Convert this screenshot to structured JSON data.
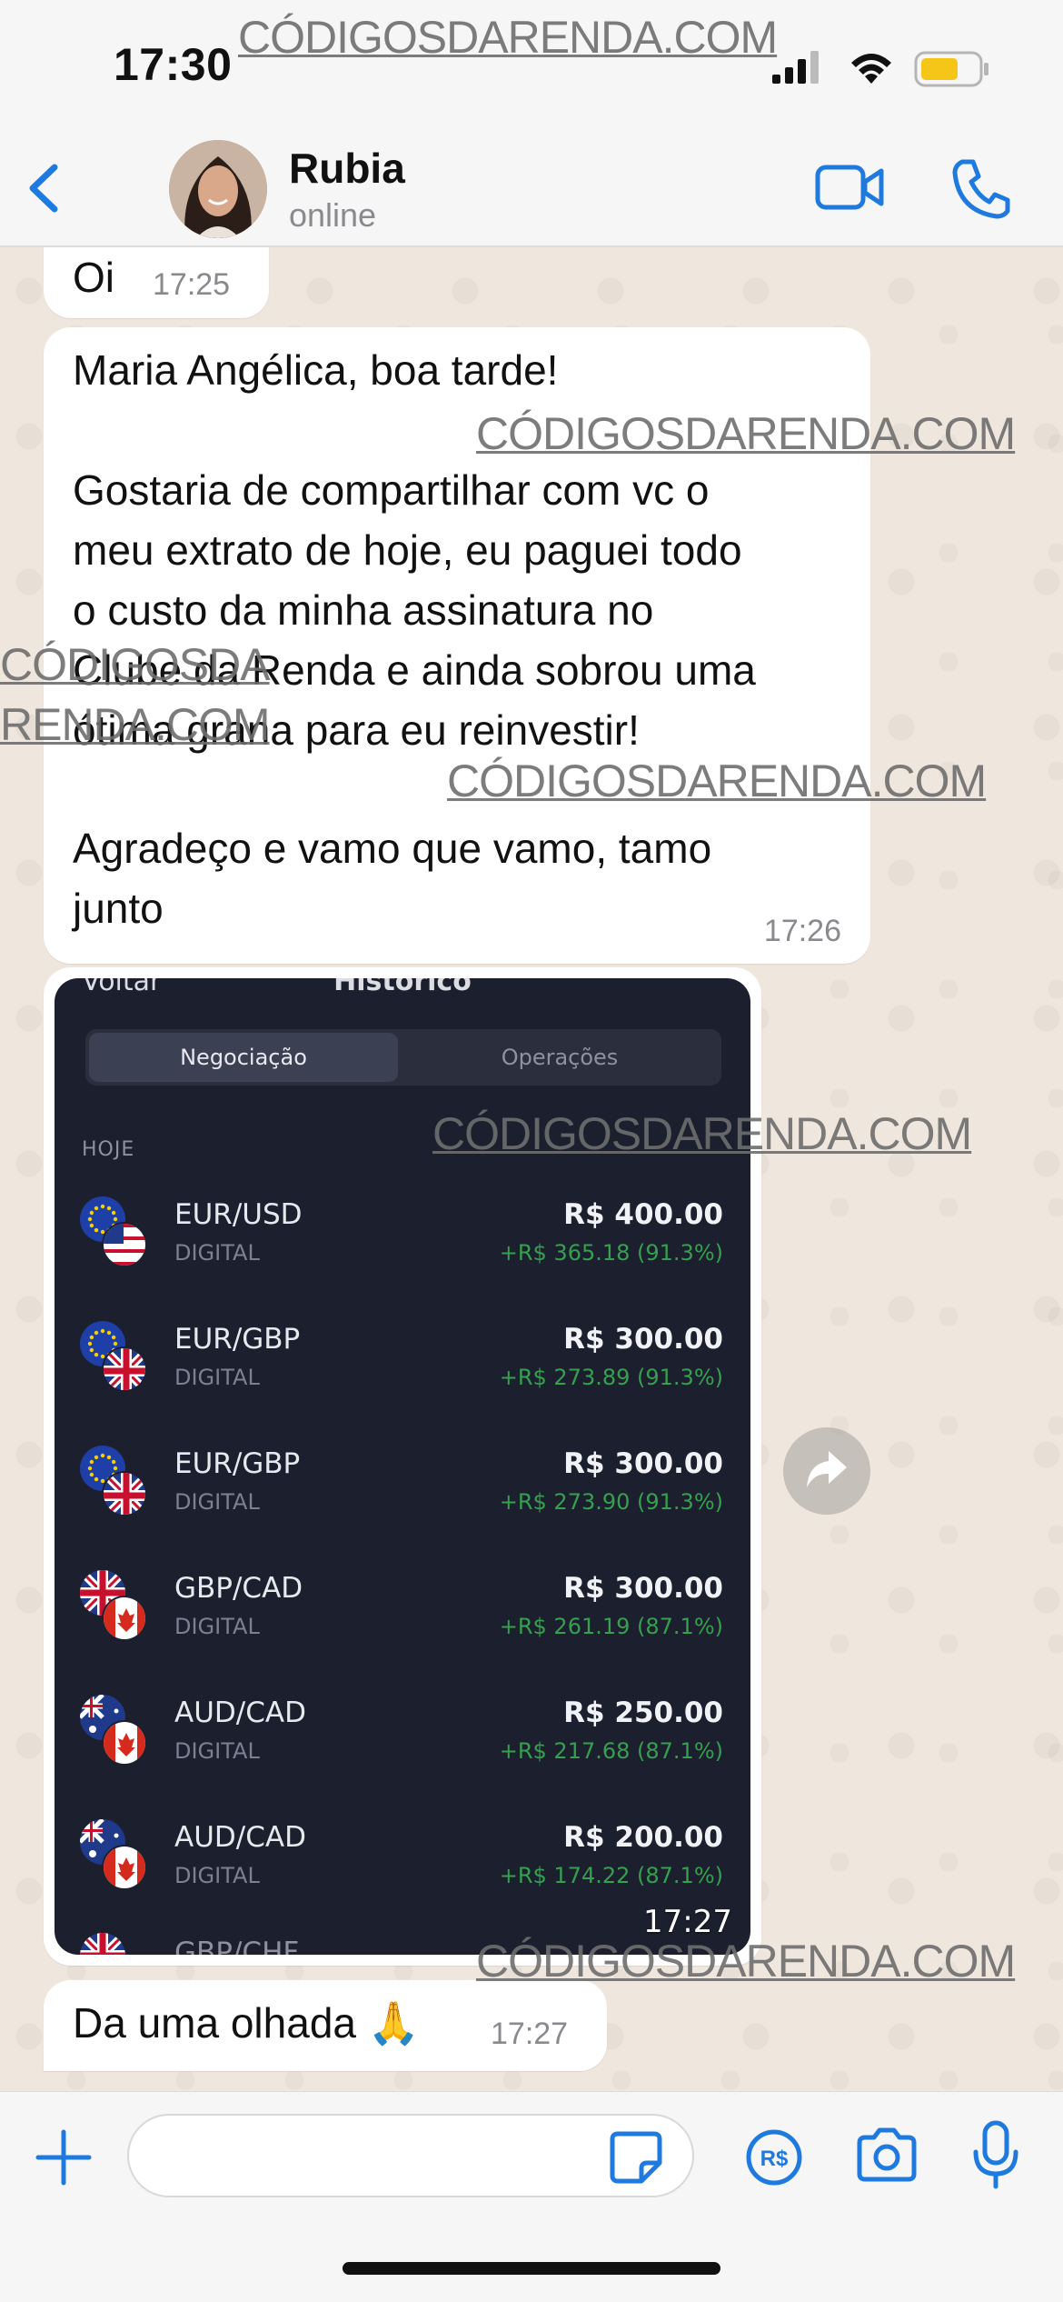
{
  "status_bar": {
    "time": "17:30",
    "icons": [
      "signal-icon",
      "wifi-icon",
      "battery-icon"
    ]
  },
  "header": {
    "contact_name": "Rubia",
    "contact_status": "online",
    "icons": [
      "back-chevron-icon",
      "video-call-icon",
      "phone-icon"
    ]
  },
  "messages": {
    "oi": {
      "text": "Oi",
      "time": "17:25"
    },
    "long": {
      "p1": "Maria Angélica, boa tarde!",
      "p2_lines": [
        "Gostaria de compartilhar com vc o",
        "meu extrato de hoje, eu paguei todo",
        "o custo da minha assinatura no",
        "Clube da Renda e ainda sobrou uma",
        "ótima grana para eu reinvestir!"
      ],
      "p3_lines": [
        "Agradeço e vamo que vamo, tamo",
        "junto"
      ],
      "time": "17:26"
    },
    "image": {
      "time": "17:27",
      "nav_back": "Voltar",
      "nav_title": "Histórico",
      "tab_active": "Negociação",
      "tab_inactive": "Operações",
      "section": "HOJE",
      "trades": [
        {
          "pair": "EUR/USD",
          "kind": "DIGITAL",
          "amount": "R$ 400.00",
          "profit": "+R$ 365.18 (91.3%)",
          "flags": [
            "eu",
            "us"
          ]
        },
        {
          "pair": "EUR/GBP",
          "kind": "DIGITAL",
          "amount": "R$ 300.00",
          "profit": "+R$ 273.89 (91.3%)",
          "flags": [
            "eu",
            "gb"
          ]
        },
        {
          "pair": "EUR/GBP",
          "kind": "DIGITAL",
          "amount": "R$ 300.00",
          "profit": "+R$ 273.90 (91.3%)",
          "flags": [
            "eu",
            "gb"
          ]
        },
        {
          "pair": "GBP/CAD",
          "kind": "DIGITAL",
          "amount": "R$ 300.00",
          "profit": "+R$ 261.19 (87.1%)",
          "flags": [
            "gb",
            "ca"
          ]
        },
        {
          "pair": "AUD/CAD",
          "kind": "DIGITAL",
          "amount": "R$ 250.00",
          "profit": "+R$ 217.68 (87.1%)",
          "flags": [
            "au",
            "ca"
          ]
        },
        {
          "pair": "AUD/CAD",
          "kind": "DIGITAL",
          "amount": "R$ 200.00",
          "profit": "+R$ 174.22 (87.1%)",
          "flags": [
            "au",
            "ca"
          ]
        }
      ],
      "partial_pair": "GBP/CHF"
    },
    "last": {
      "text": "Da uma olhada 🙏",
      "time": "17:27"
    }
  },
  "watermark": "CÓDIGOSDARENDA.COM",
  "watermark_split": [
    "CÓDIGOSDA",
    "RENDA.COM"
  ],
  "input": {
    "placeholder": ""
  },
  "colors": {
    "accent": "#1f7ae0",
    "profit": "#35a04d",
    "screenshot_bg": "#1c1f2e"
  }
}
